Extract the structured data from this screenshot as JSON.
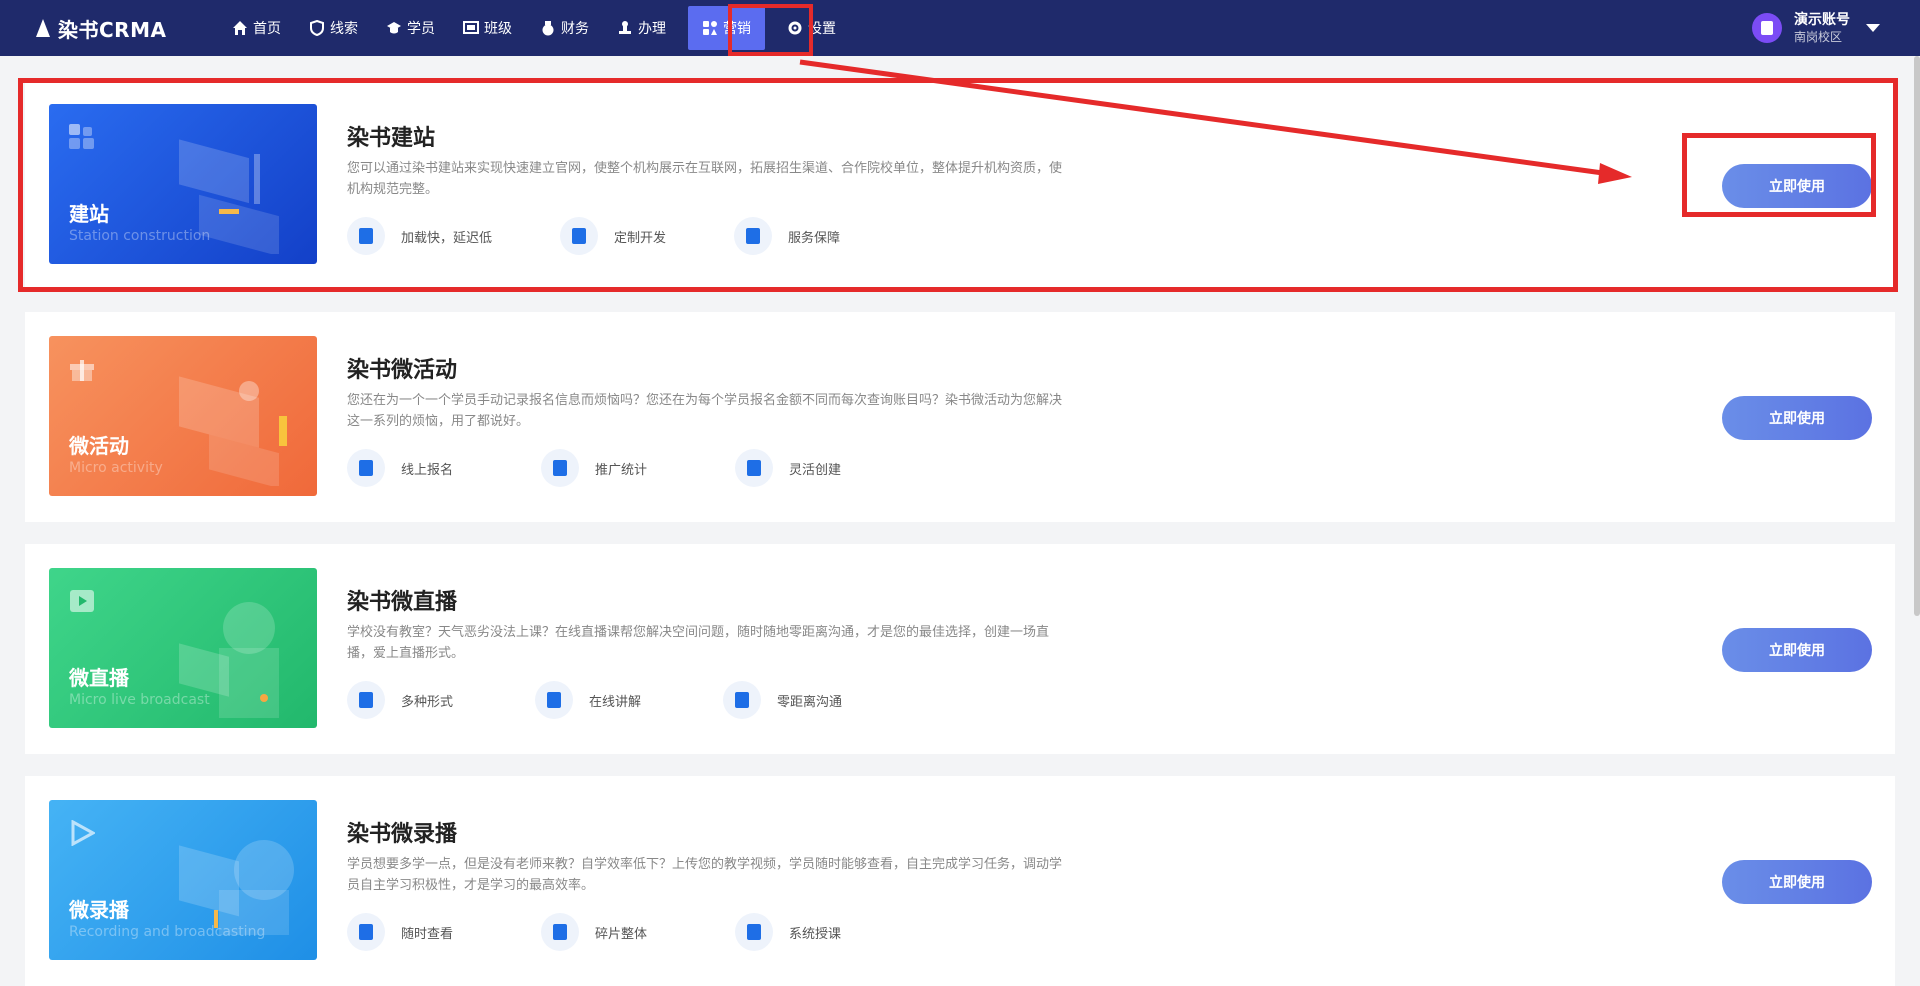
{
  "app": {
    "logo_text": "染书CRMA"
  },
  "nav": {
    "items": [
      {
        "label": "首页",
        "icon": "home-icon"
      },
      {
        "label": "线索",
        "icon": "shield-icon"
      },
      {
        "label": "学员",
        "icon": "graduation-cap-icon"
      },
      {
        "label": "班级",
        "icon": "class-board-icon"
      },
      {
        "label": "财务",
        "icon": "money-bag-icon"
      },
      {
        "label": "办理",
        "icon": "stamp-icon"
      },
      {
        "label": "营销",
        "icon": "marketing-icon",
        "active": true
      },
      {
        "label": "设置",
        "icon": "gear-icon"
      }
    ]
  },
  "user": {
    "name": "演示账号",
    "campus": "南岗校区"
  },
  "cards": [
    {
      "banner_cn": "建站",
      "banner_en": "Station construction",
      "banner_color": "#1f55e0",
      "title": "染书建站",
      "desc": "您可以通过染书建站来实现快速建立官网，使整个机构展示在互联网，拓展招生渠道、合作院校单位，整体提升机构资质，使机构规范完整。",
      "features": [
        "加载快，延迟低",
        "定制开发",
        "服务保障"
      ],
      "button": "立即使用"
    },
    {
      "banner_cn": "微活动",
      "banner_en": "Micro activity",
      "banner_color": "#f47a48",
      "title": "染书微活动",
      "desc": "您还在为一个一个学员手动记录报名信息而烦恼吗？您还在为每个学员报名金额不同而每次查询账目吗？染书微活动为您解决这一系列的烦恼，用了都说好。",
      "features": [
        "线上报名",
        "推广统计",
        "灵活创建"
      ],
      "button": "立即使用"
    },
    {
      "banner_cn": "微直播",
      "banner_en": "Micro live broadcast",
      "banner_color": "#2ecb7e",
      "title": "染书微直播",
      "desc": "学校没有教室？天气恶劣没法上课？在线直播课帮您解决空间问题，随时随地零距离沟通，才是您的最佳选择，创建一场直播，爱上直播形式。",
      "features": [
        "多种形式",
        "在线讲解",
        "零距离沟通"
      ],
      "button": "立即使用"
    },
    {
      "banner_cn": "微录播",
      "banner_en": "Recording and broadcasting",
      "banner_color": "#2ea3ef",
      "title": "染书微录播",
      "desc": "学员想要多学一点，但是没有老师来教？自学效率低下？上传您的教学视频，学员随时能够查看，自主完成学习任务，调动学员自主学习积极性，才是学习的最高效率。",
      "features": [
        "随时查看",
        "碎片整体",
        "系统授课"
      ],
      "button": "立即使用"
    }
  ],
  "colors": {
    "topbar": "#1f2a6b",
    "nav_active": "#5b6cf0",
    "annotation": "#e52a2a",
    "button": "#5b72e2"
  }
}
